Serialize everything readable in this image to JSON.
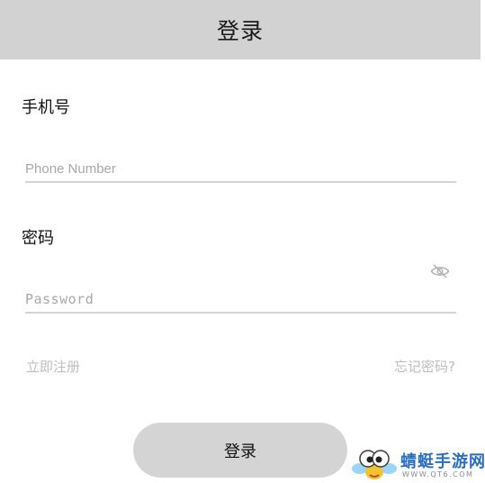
{
  "header": {
    "title": "登录"
  },
  "form": {
    "phone": {
      "label": "手机号",
      "placeholder": "Phone Number",
      "value": ""
    },
    "password": {
      "label": "密码",
      "placeholder": "Password",
      "value": "",
      "toggle_icon": "eye-slash-icon"
    }
  },
  "links": {
    "register": "立即注册",
    "forgot": "忘记密码?"
  },
  "actions": {
    "login_label": "登录"
  },
  "watermark": {
    "name": "蜻蜓手游网",
    "url": "WWW.QT6.COM",
    "icon": "dragonfly-mascot-logo"
  },
  "colors": {
    "header_bg": "#d2d2d2",
    "button_bg": "#d4d4d4",
    "link": "#bdbdbd",
    "placeholder": "#a8a8a8",
    "underline": "#d4d4d4"
  }
}
